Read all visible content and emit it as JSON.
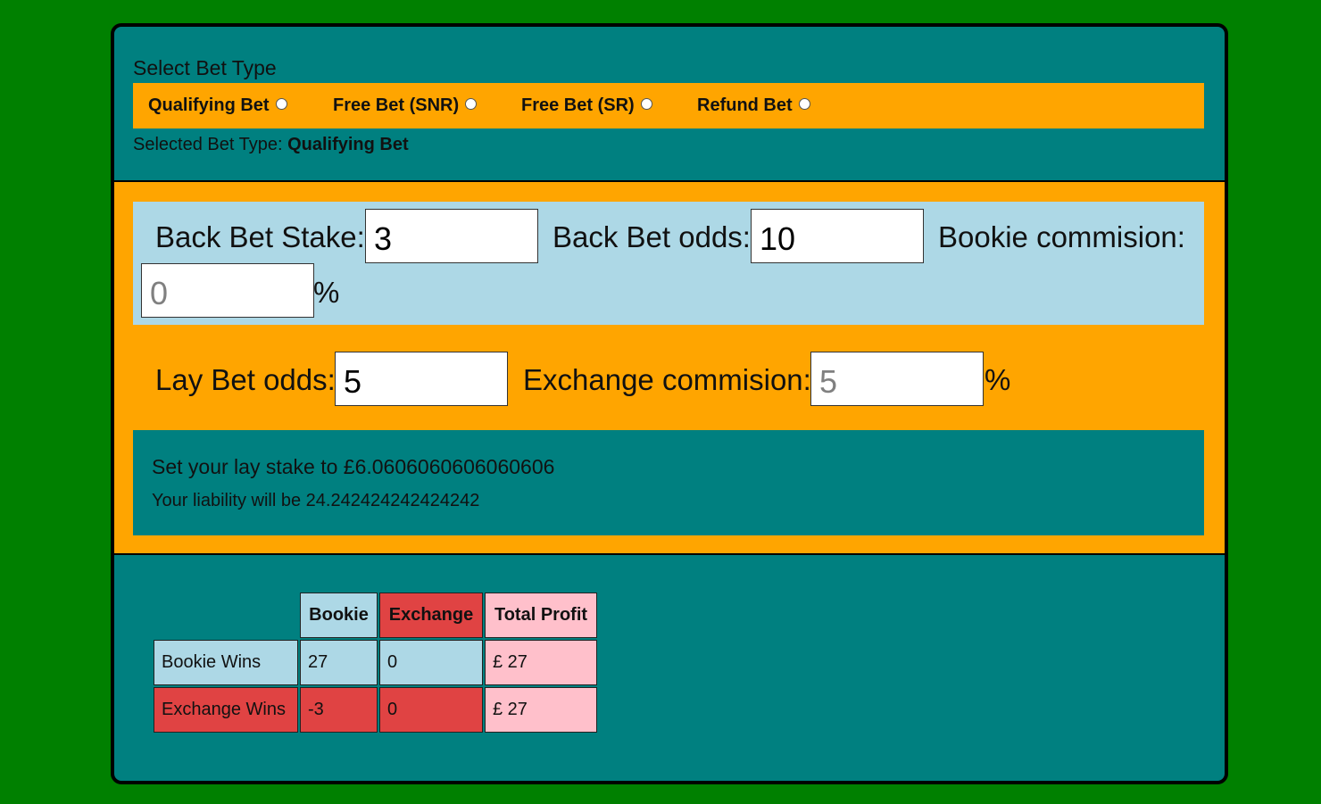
{
  "bet_type": {
    "title": "Select Bet Type",
    "options": [
      {
        "label": "Qualifying Bet",
        "selected": false
      },
      {
        "label": "Free Bet (SNR)",
        "selected": false
      },
      {
        "label": "Free Bet (SR)",
        "selected": false
      },
      {
        "label": "Refund Bet",
        "selected": false
      }
    ],
    "selected_prefix": "Selected Bet Type: ",
    "selected_value": "Qualifying Bet"
  },
  "inputs": {
    "back_stake_label": "Back Bet Stake:",
    "back_stake_value": "3",
    "back_odds_label": "Back Bet odds:",
    "back_odds_value": "10",
    "bookie_commission_label": "Bookie commision:",
    "bookie_commission_placeholder": "0",
    "bookie_commission_unit": "%",
    "lay_odds_label": "Lay Bet odds:",
    "lay_odds_value": "5",
    "exchange_commission_label": "Exchange commision:",
    "exchange_commission_placeholder": "5",
    "exchange_commission_unit": "%"
  },
  "result": {
    "lay_stake_text": "Set your lay stake to £6.0606060606060606",
    "liability_text": "Your liability will be 24.242424242424242"
  },
  "colors": {
    "page_bg": "#008000",
    "teal": "#008080",
    "orange": "#FFA500",
    "light_blue": "#ADD8E6",
    "red": "#E04343",
    "pink": "#FFC0CB"
  },
  "table": {
    "headers": [
      "Bookie",
      "Exchange",
      "Total Profit"
    ],
    "rows": [
      {
        "label": "Bookie Wins",
        "bookie": "27",
        "exchange": "0",
        "total": "£ 27"
      },
      {
        "label": "Exchange Wins",
        "bookie": "-3",
        "exchange": "0",
        "total": "£ 27"
      }
    ]
  }
}
